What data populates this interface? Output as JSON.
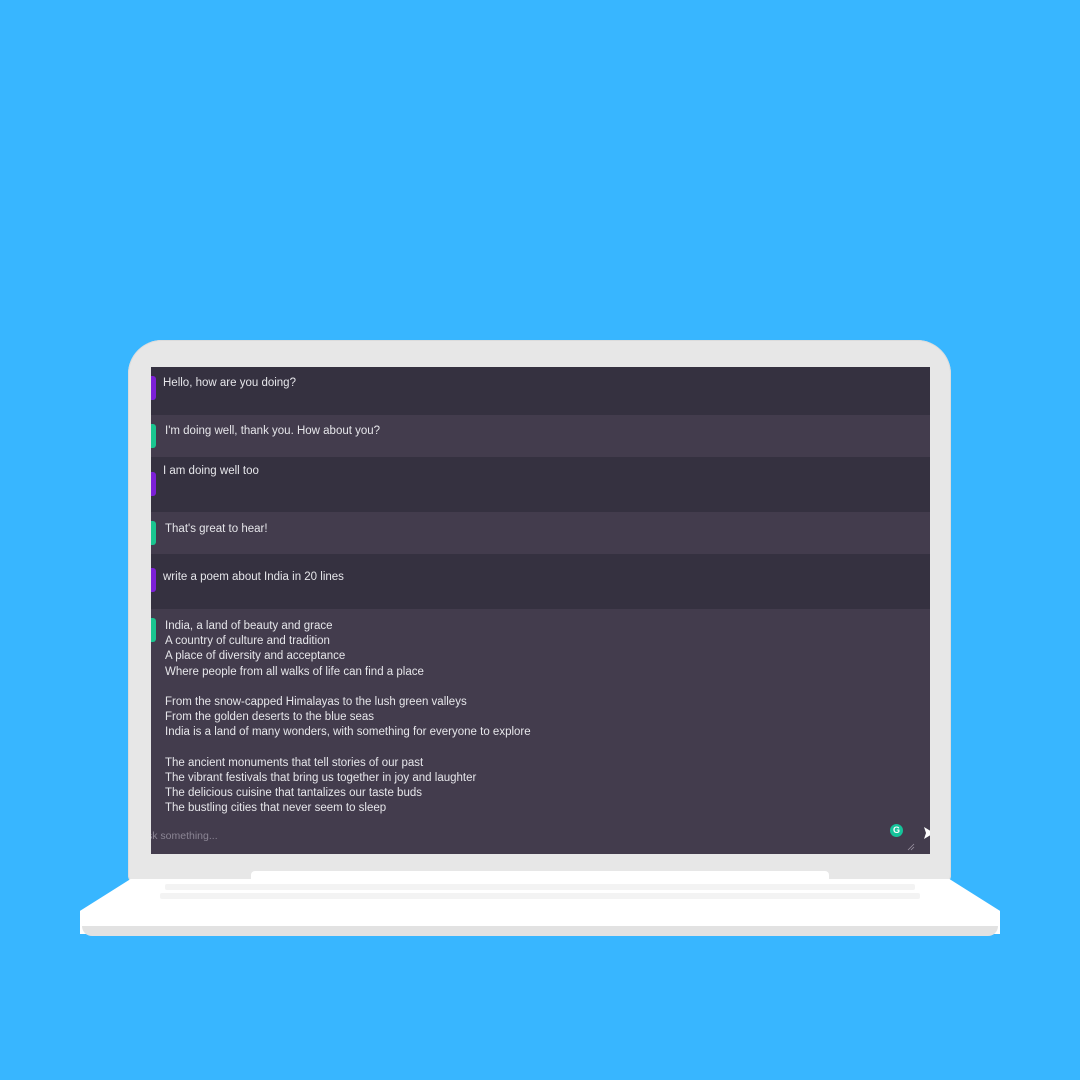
{
  "colors": {
    "background": "#38b6ff",
    "chat_bg": "#433c4d",
    "user_row_bg": "#353140",
    "user_accent": "#7c1fd6",
    "bot_accent": "#19c58f",
    "text": "#e6e6ea"
  },
  "messages": [
    {
      "role": "user",
      "text": "Hello, how are you doing?"
    },
    {
      "role": "bot",
      "text": "I'm doing well, thank you. How about you?"
    },
    {
      "role": "user",
      "text": "I am doing well too"
    },
    {
      "role": "bot",
      "text": "That's great to hear!"
    },
    {
      "role": "user",
      "text": "write a poem about India in 20 lines"
    },
    {
      "role": "bot",
      "text": "India, a land of beauty and grace\nA country of culture and tradition\nA place of diversity and acceptance\nWhere people from all walks of life can find a place\n\nFrom the snow-capped Himalayas to the lush green valleys\nFrom the golden deserts to the blue seas\nIndia is a land of many wonders, with something for everyone to explore\n\nThe ancient monuments that tell stories of our past\nThe vibrant festivals that bring us together in joy and laughter\nThe delicious cuisine that tantalizes our taste buds\nThe bustling cities that never seem to sleep"
    }
  ],
  "input": {
    "placeholder": "sk something..."
  },
  "icons": {
    "grammarly": "grammarly-icon",
    "grammarly_letter": "G",
    "send": "send-icon",
    "resize": "resize-handle-icon"
  }
}
